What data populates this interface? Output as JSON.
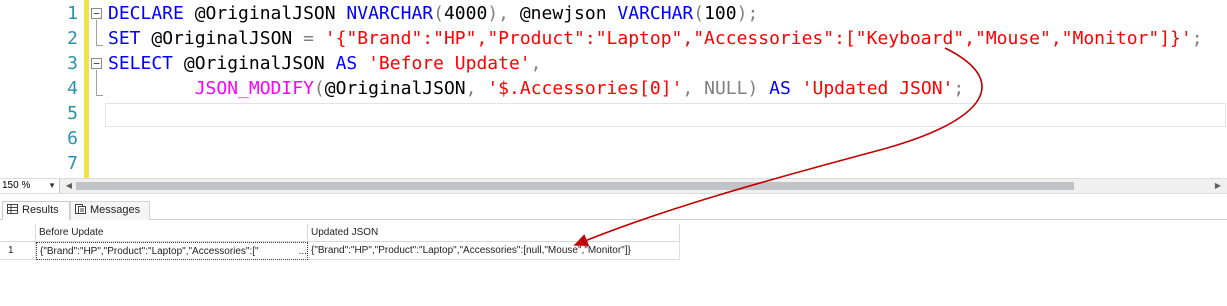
{
  "editor": {
    "line_numbers": [
      "1",
      "2",
      "3",
      "4",
      "5",
      "6",
      "7"
    ],
    "lines": [
      [
        {
          "t": "DECLARE ",
          "c": "kw"
        },
        {
          "t": "@OriginalJSON ",
          "c": "tx"
        },
        {
          "t": "NVARCHAR",
          "c": "kw"
        },
        {
          "t": "(",
          "c": "gr"
        },
        {
          "t": "4000",
          "c": "tx"
        },
        {
          "t": "), ",
          "c": "gr"
        },
        {
          "t": "@newjson ",
          "c": "tx"
        },
        {
          "t": "VARCHAR",
          "c": "kw"
        },
        {
          "t": "(",
          "c": "gr"
        },
        {
          "t": "100",
          "c": "tx"
        },
        {
          "t": ");",
          "c": "gr"
        }
      ],
      [
        {
          "t": "SET ",
          "c": "kw"
        },
        {
          "t": "@OriginalJSON ",
          "c": "tx"
        },
        {
          "t": "= ",
          "c": "gr"
        },
        {
          "t": "'{\"Brand\":\"HP\",\"Product\":\"Laptop\",\"Accessories\":[\"Keyboard\",\"Mouse\",\"Monitor\"]}'",
          "c": "str"
        },
        {
          "t": ";",
          "c": "gr"
        }
      ],
      [
        {
          "t": "SELECT ",
          "c": "kw"
        },
        {
          "t": "@OriginalJSON ",
          "c": "tx"
        },
        {
          "t": "AS ",
          "c": "kw"
        },
        {
          "t": "'Before Update'",
          "c": "str"
        },
        {
          "t": ",",
          "c": "gr"
        }
      ],
      [
        {
          "t": "        ",
          "c": "tx"
        },
        {
          "t": "JSON_MODIFY",
          "c": "fn"
        },
        {
          "t": "(",
          "c": "gr"
        },
        {
          "t": "@OriginalJSON",
          "c": "tx"
        },
        {
          "t": ", ",
          "c": "gr"
        },
        {
          "t": "'$.Accessories[0]'",
          "c": "str"
        },
        {
          "t": ", ",
          "c": "gr"
        },
        {
          "t": "NULL",
          "c": "gr"
        },
        {
          "t": ") ",
          "c": "gr"
        },
        {
          "t": "AS ",
          "c": "kw"
        },
        {
          "t": "'Updated JSON'",
          "c": "str"
        },
        {
          "t": ";",
          "c": "gr"
        }
      ],
      [],
      [],
      []
    ]
  },
  "status": {
    "zoom": "150 %"
  },
  "tabs": {
    "results": "Results",
    "messages": "Messages"
  },
  "grid": {
    "headers": [
      "Before Update",
      "Updated JSON"
    ],
    "rows": [
      {
        "num": "1",
        "before": "{\"Brand\":\"HP\",\"Product\":\"Laptop\",\"Accessories\":[\"",
        "before_ellipsis": "...",
        "updated": "{\"Brand\":\"HP\",\"Product\":\"Laptop\",\"Accessories\":[null,\"Mouse\",\"Monitor\"]}"
      }
    ]
  },
  "colors": {
    "keyword": "#0000ff",
    "string": "#ff0000",
    "function": "#ff00ff",
    "operator": "#808080",
    "line_number": "#2b91af",
    "arrow": "#c00000"
  }
}
